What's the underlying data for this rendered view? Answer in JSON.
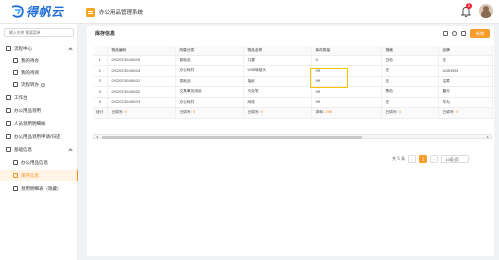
{
  "header": {
    "logo_text": "得帆云",
    "system_title": "办公用品管理系统",
    "notification_count": "2"
  },
  "sidebar": {
    "search_placeholder": "输入名称 搜索菜单",
    "items": [
      {
        "label": "流程中心"
      },
      {
        "label": "我的待办"
      },
      {
        "label": "我的待阅"
      },
      {
        "label": "流程转办"
      },
      {
        "label": "工作台"
      },
      {
        "label": "办公用品领用"
      },
      {
        "label": "人员领用明细帐"
      },
      {
        "label": "办公用品领用申请/归还"
      },
      {
        "label": "基础信息"
      },
      {
        "label": "办公用品信息"
      },
      {
        "label": "库存信息"
      },
      {
        "label": "领用明细表（隐藏）"
      }
    ]
  },
  "panel": {
    "title": "库存信息",
    "add_label": "新增"
  },
  "table": {
    "headers": [
      "",
      "物品编码",
      "所属分类",
      "物品名称",
      "库存数量",
      "规格",
      "品牌"
    ],
    "rows": [
      [
        "1",
        "OS2023040005",
        "易耗品",
        "口罩",
        "0",
        "白色",
        "无"
      ],
      [
        "2",
        "OS2023040004",
        "办公耗材",
        "USB转接头",
        "99",
        "无",
        "UGREEN"
      ],
      [
        "3",
        "OS2023040001",
        "易耗品",
        "抽纸",
        "99",
        "无",
        "洁柔"
      ],
      [
        "4",
        "OS2023040002",
        "文具事务用品",
        "马克笔",
        "99",
        "黑色",
        "晨光"
      ],
      [
        "5",
        "OS2023040003",
        "办公耗材",
        "网线",
        "99",
        "无",
        "华为"
      ]
    ],
    "total_row": [
      "统计",
      "已填写: ",
      "已填写: ",
      "已填写: ",
      "求和: ",
      "已填写: ",
      "已填写: "
    ],
    "total_values": [
      "5",
      "5",
      "5",
      "396",
      "5",
      "5"
    ]
  },
  "pagination": {
    "summary": "共 5 条",
    "current_page": "1",
    "page_size": "10条/页"
  },
  "colors": {
    "accent": "#fa9d28",
    "brand": "#1f6fd6",
    "highlight": "#f5c400"
  }
}
